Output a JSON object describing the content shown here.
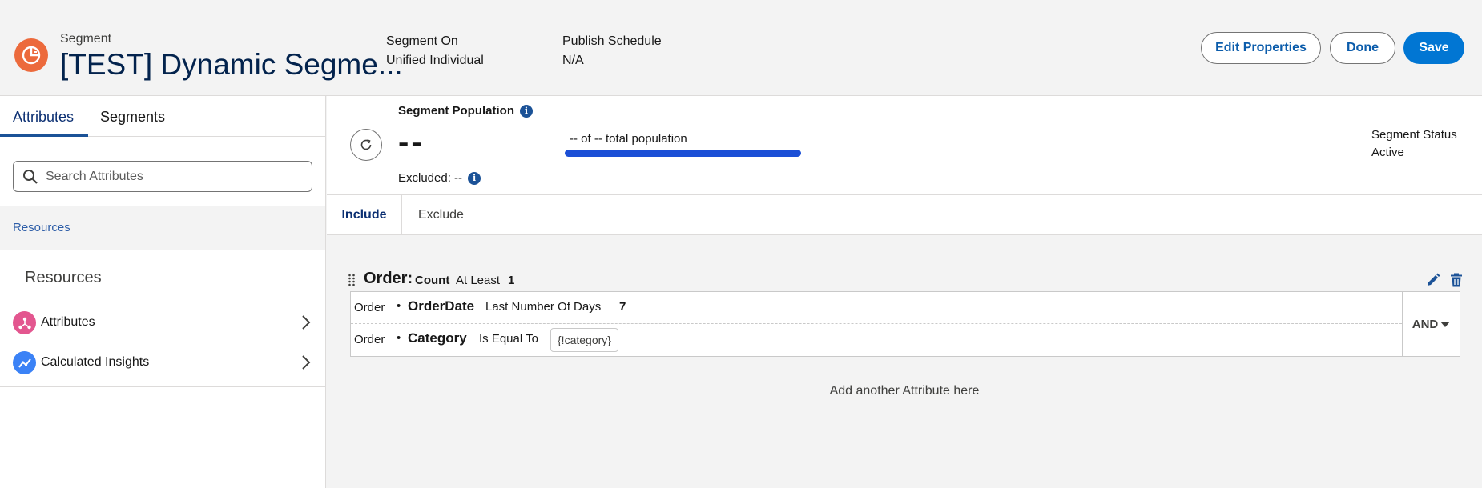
{
  "header": {
    "object_label": "Segment",
    "title": "[TEST] Dynamic Segme...",
    "segment_on_label": "Segment On",
    "segment_on_value": "Unified Individual",
    "publish_label": "Publish Schedule",
    "publish_value": "N/A",
    "buttons": {
      "edit": "Edit Properties",
      "done": "Done",
      "save": "Save"
    }
  },
  "sidebar": {
    "tabs": [
      "Attributes",
      "Segments"
    ],
    "active_tab": "Attributes",
    "search_placeholder": "Search Attributes",
    "crumb": "Resources",
    "resources_heading": "Resources",
    "items": [
      {
        "label": "Attributes",
        "icon": "attributes-icon",
        "color": "#e3568f"
      },
      {
        "label": "Calculated Insights",
        "icon": "calculated-insights-icon",
        "color": "#3b82f6"
      }
    ]
  },
  "population": {
    "title": "Segment Population",
    "count": "--",
    "excluded": "Excluded: --",
    "total": "-- of -- total population",
    "status_label": "Segment Status",
    "status_value": "Active"
  },
  "filter_tabs": {
    "include": "Include",
    "exclude": "Exclude",
    "active": "Include"
  },
  "criteria": {
    "object": "Order:",
    "aggregate": "Count",
    "operator": "At Least",
    "value": "1",
    "rules": [
      {
        "object": "Order",
        "field": "OrderDate",
        "operator": "Last Number Of Days",
        "value": "7"
      },
      {
        "object": "Order",
        "field": "Category",
        "operator": "Is Equal To",
        "value": "{!category}"
      }
    ],
    "logic": "AND",
    "add_attribute": "Add another Attribute here"
  },
  "colors": {
    "brand": "#0176d3",
    "logo": "#ec6a3c",
    "progress": "#1b4fd6"
  }
}
